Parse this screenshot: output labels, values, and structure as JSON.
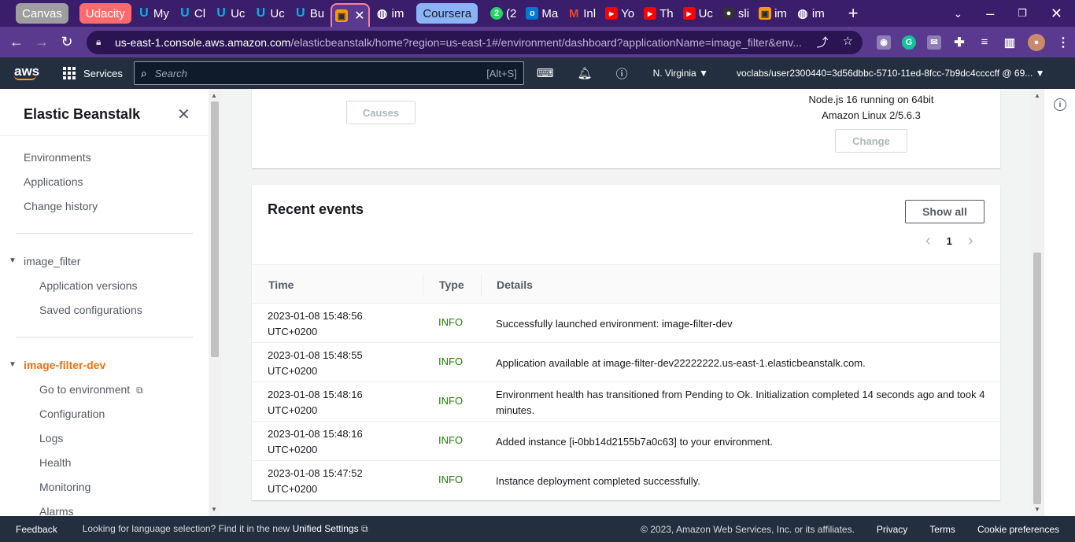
{
  "browser": {
    "tabs": [
      {
        "label": "Canvas",
        "kind": "group",
        "color": "#9e9e9e"
      },
      {
        "label": "Udacity",
        "kind": "group",
        "color": "#ff6b6b"
      },
      {
        "label": "My",
        "icon": "udacity-icon",
        "color": "#02b3e4"
      },
      {
        "label": "Cl",
        "icon": "udacity-icon",
        "color": "#02b3e4"
      },
      {
        "label": "Uc",
        "icon": "udacity-icon",
        "color": "#02b3e4"
      },
      {
        "label": "Uc",
        "icon": "udacity-icon",
        "color": "#02b3e4"
      },
      {
        "label": "Bu",
        "icon": "udacity-icon",
        "color": "#02b3e4"
      },
      {
        "label": "",
        "icon": "aws-cube-icon",
        "color": "#ff9900",
        "active": true
      },
      {
        "label": "im",
        "icon": "globe-icon",
        "color": "#ffffff"
      },
      {
        "label": "Coursera",
        "kind": "group",
        "color": "#8ab4f8"
      },
      {
        "label": "(2",
        "icon": "whatsapp-icon",
        "color": "#25d366"
      },
      {
        "label": "Ma",
        "icon": "outlook-icon",
        "color": "#0078d4"
      },
      {
        "label": "Inl",
        "icon": "gmail-icon",
        "color": "#ea4335"
      },
      {
        "label": "Yo",
        "icon": "youtube-icon",
        "color": "#ff0000"
      },
      {
        "label": "Th",
        "icon": "youtube-icon",
        "color": "#ff0000"
      },
      {
        "label": "Uc",
        "icon": "youtube-icon",
        "color": "#ff0000"
      },
      {
        "label": "sli",
        "icon": "github-icon",
        "color": "#333333"
      },
      {
        "label": "im",
        "icon": "aws-cube-icon",
        "color": "#ff9900"
      },
      {
        "label": "im",
        "icon": "globe-icon",
        "color": "#ffffff"
      }
    ],
    "url_host": "us-east-1.console.aws.amazon.com",
    "url_path": "/elasticbeanstalk/home?region=us-east-1#/environment/dashboard?applicationName=image_filter&env..."
  },
  "aws": {
    "services_label": "Services",
    "search_placeholder": "Search",
    "search_shortcut": "[Alt+S]",
    "region": "N. Virginia",
    "account": "voclabs/user2300440=3d56dbbc-5710-11ed-8fcc-7b9dc4ccccff @ 69..."
  },
  "sidebar": {
    "title": "Elastic Beanstalk",
    "top_links": [
      "Environments",
      "Applications",
      "Change history"
    ],
    "app_name": "image_filter",
    "app_links": [
      "Application versions",
      "Saved configurations"
    ],
    "env_name": "image-filter-dev",
    "env_links": [
      "Go to environment",
      "Configuration",
      "Logs",
      "Health",
      "Monitoring",
      "Alarms"
    ]
  },
  "top_card": {
    "causes_label": "Causes",
    "platform_line1": "Node.js 16 running on 64bit",
    "platform_line2": "Amazon Linux 2/5.6.3",
    "change_label": "Change"
  },
  "events": {
    "title": "Recent events",
    "show_all": "Show all",
    "page": "1",
    "columns": [
      "Time",
      "Type",
      "Details"
    ],
    "rows": [
      {
        "time1": "2023-01-08 15:48:56",
        "time2": "UTC+0200",
        "type": "INFO",
        "details": "Successfully launched environment: image-filter-dev"
      },
      {
        "time1": "2023-01-08 15:48:55",
        "time2": "UTC+0200",
        "type": "INFO",
        "details": "Application available at image-filter-dev22222222.us-east-1.elasticbeanstalk.com."
      },
      {
        "time1": "2023-01-08 15:48:16",
        "time2": "UTC+0200",
        "type": "INFO",
        "details": "Environment health has transitioned from Pending to Ok. Initialization completed 14 seconds ago and took 4 minutes."
      },
      {
        "time1": "2023-01-08 15:48:16",
        "time2": "UTC+0200",
        "type": "INFO",
        "details": "Added instance [i-0bb14d2155b7a0c63] to your environment."
      },
      {
        "time1": "2023-01-08 15:47:52",
        "time2": "UTC+0200",
        "type": "INFO",
        "details": "Instance deployment completed successfully."
      }
    ]
  },
  "footer": {
    "feedback": "Feedback",
    "lang_text": "Looking for language selection? Find it in the new",
    "lang_link": "Unified Settings",
    "copyright": "© 2023, Amazon Web Services, Inc. or its affiliates.",
    "privacy": "Privacy",
    "terms": "Terms",
    "cookies": "Cookie preferences"
  }
}
